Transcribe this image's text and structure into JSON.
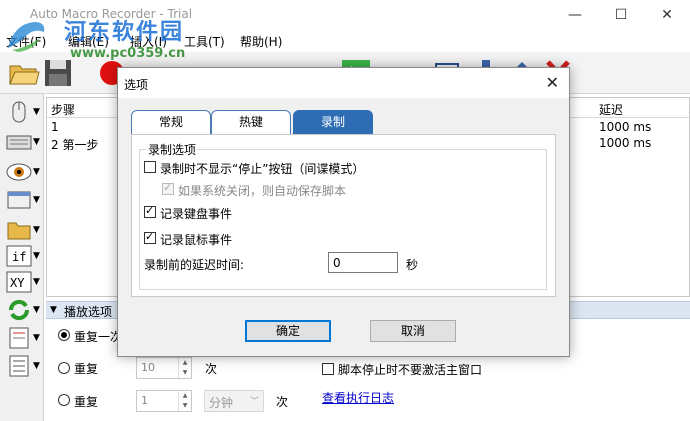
{
  "app": {
    "title": "Auto Macro Recorder - Trial",
    "window_controls": [
      "—",
      "☐",
      "✕"
    ]
  },
  "watermark": {
    "line1": "河东软件园",
    "line2": "www.pc0359.cn"
  },
  "menu": {
    "items": [
      "文件(F)",
      "编辑(E)",
      "插入(I)",
      "工具(T)",
      "帮助(H)"
    ]
  },
  "steps": {
    "columns": {
      "step": "步骤",
      "delay": "延迟"
    },
    "rows": [
      {
        "step": "1",
        "delay": "1000 ms"
      },
      {
        "step": "2  第一步",
        "delay": "1000 ms"
      }
    ]
  },
  "playback": {
    "header": "播放选项",
    "repeat_once": "重复一次",
    "repeat_n_label": "重复",
    "repeat_n_value": "10",
    "repeat_n_unit": "次",
    "repeat_time_label": "重复",
    "repeat_time_value": "1",
    "repeat_time_unit_select": "分钟",
    "repeat_time_unit": "次",
    "no_activate_label": "脚本停止时不要激活主窗口",
    "log_link": "查看执行日志"
  },
  "dialog": {
    "title": "选项",
    "tabs": [
      "常规",
      "热键",
      "录制"
    ],
    "active_tab": "录制",
    "group_label": "录制选项",
    "opt_hide_stop": "录制时不显示“停止”按钮（间谍模式）",
    "opt_autosave": "如果系统关闭，则自动保存脚本",
    "opt_keyboard": "记录键盘事件",
    "opt_mouse": "记录鼠标事件",
    "delay_label": "录制前的延迟时间:",
    "delay_value": "0",
    "delay_unit": "秒",
    "ok": "确定",
    "cancel": "取消"
  },
  "colors": {
    "tab_active": "#2e6db4",
    "playback_header": "#dce6f2",
    "link": "#0000cc"
  }
}
